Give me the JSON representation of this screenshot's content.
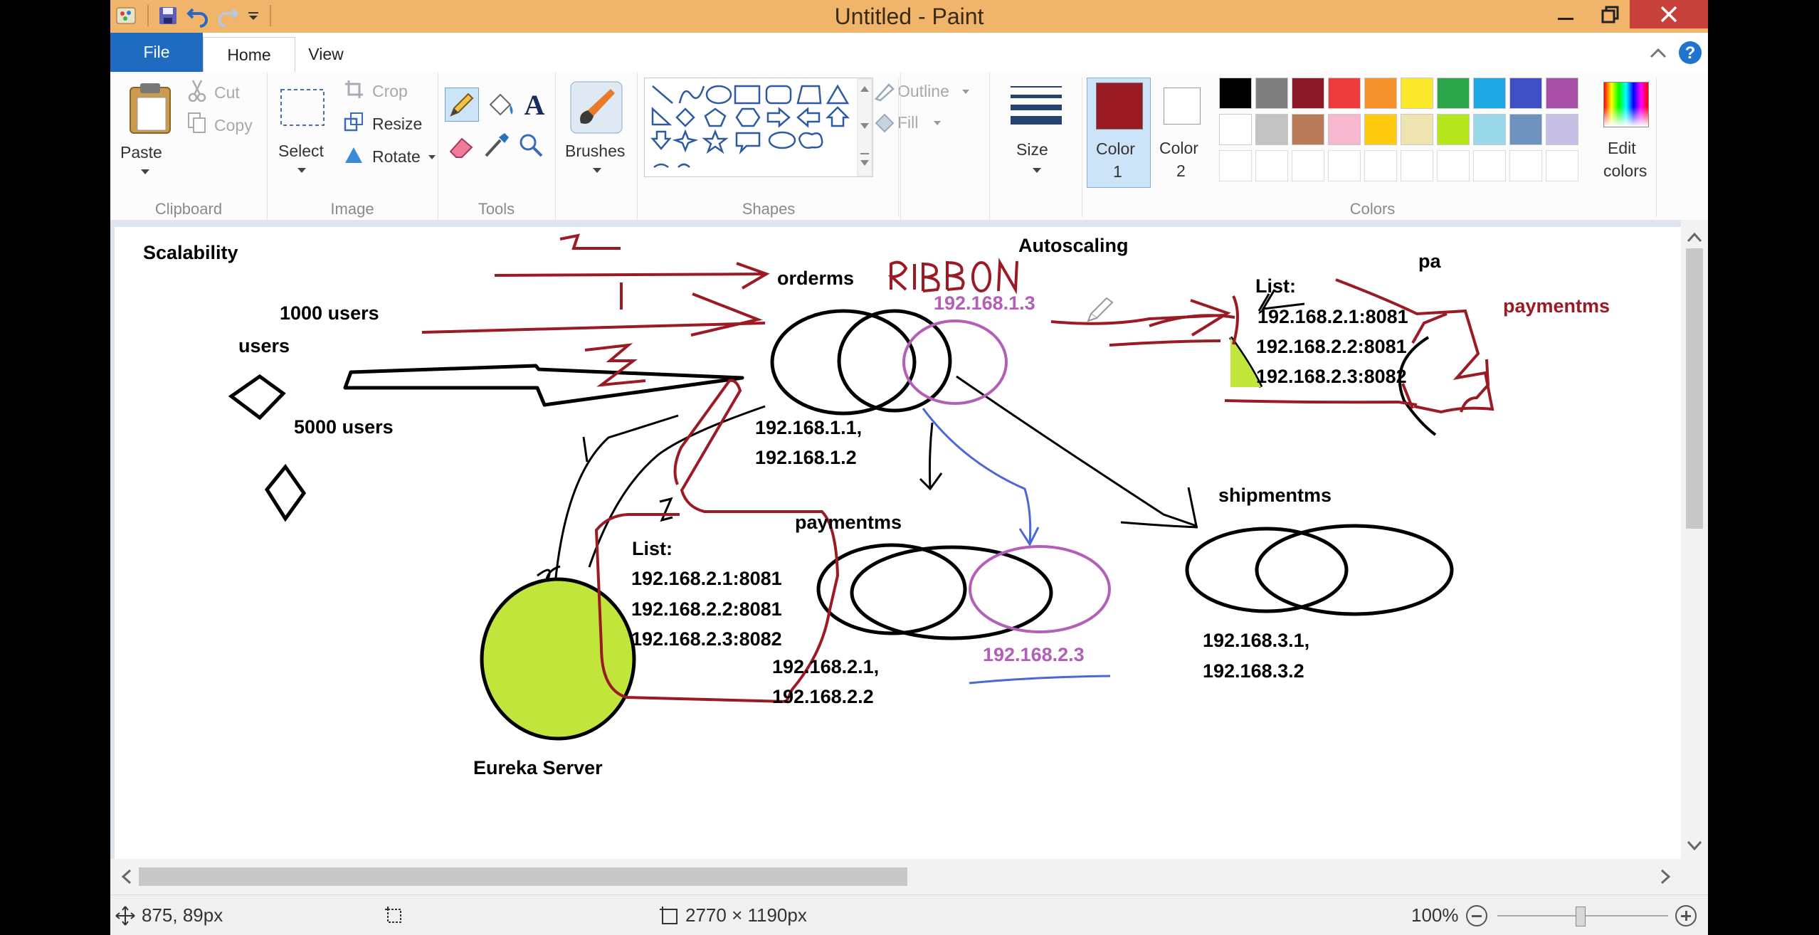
{
  "window": {
    "title": "Untitled - Paint"
  },
  "tabs": {
    "file": "File",
    "home": "Home",
    "view": "View"
  },
  "ribbon": {
    "clipboard": {
      "label": "Clipboard",
      "paste": "Paste",
      "cut": "Cut",
      "copy": "Copy"
    },
    "image": {
      "label": "Image",
      "select": "Select",
      "crop": "Crop",
      "resize": "Resize",
      "rotate": "Rotate"
    },
    "tools": {
      "label": "Tools"
    },
    "brushes": {
      "label": "Brushes"
    },
    "shapes": {
      "label": "Shapes",
      "outline": "Outline",
      "fill": "Fill"
    },
    "size": {
      "label": "Size"
    },
    "colors": {
      "label": "Colors",
      "color1": "Color",
      "color1_num": "1",
      "color2": "Color",
      "color2_num": "2",
      "edit": "Edit",
      "edit2": "colors",
      "color1_value": "#9b1b24",
      "palette_row1": [
        "#000000",
        "#7f7f7f",
        "#8b1a28",
        "#ee3b3b",
        "#f5922b",
        "#fbe82b",
        "#2ba44a",
        "#1ea9e4",
        "#3f4fc4",
        "#a64ea8"
      ],
      "palette_row2": [
        "#ffffff",
        "#c3c3c3",
        "#b97a57",
        "#f7b7cf",
        "#ffc90e",
        "#efe4b0",
        "#b5e61d",
        "#99d9ea",
        "#7092be",
        "#c8bfe7"
      ]
    }
  },
  "drawing": {
    "scalability": "Scalability",
    "users_1000": "1000 users",
    "users": "users",
    "users_5000": "5000 users",
    "orderms": "orderms",
    "ribbon_word": "RIBBON",
    "autoscaling": "Autoscaling",
    "ip_1_3": "192.168.1.3",
    "orderms_ips_1": "192.168.1.1,",
    "orderms_ips_2": "192.168.1.2",
    "list_right": "List:",
    "list_right_1": "192.168.2.1:8081",
    "list_right_2": "192.168.2.2:8081",
    "list_right_3": "192.168.2.3:8082",
    "pa": "pa",
    "paymentms_red": "paymentms",
    "shipmentms": "shipmentms",
    "shipment_ips_1": "192.168.3.1,",
    "shipment_ips_2": "192.168.3.2",
    "paymentms": "paymentms",
    "list_left": "List:",
    "list_left_1": "192.168.2.1:8081",
    "list_left_2": "192.168.2.2:8081",
    "list_left_3": "192.168.2.3:8082",
    "payment_ips_1": "192.168.2.1,",
    "payment_ips_2": "192.168.2.2",
    "ip_2_3": "192.168.2.3",
    "eureka": "Eureka Server"
  },
  "status": {
    "cursor_pos": "875, 89px",
    "canvas_size": "2770 × 1190px",
    "zoom": "100%"
  }
}
